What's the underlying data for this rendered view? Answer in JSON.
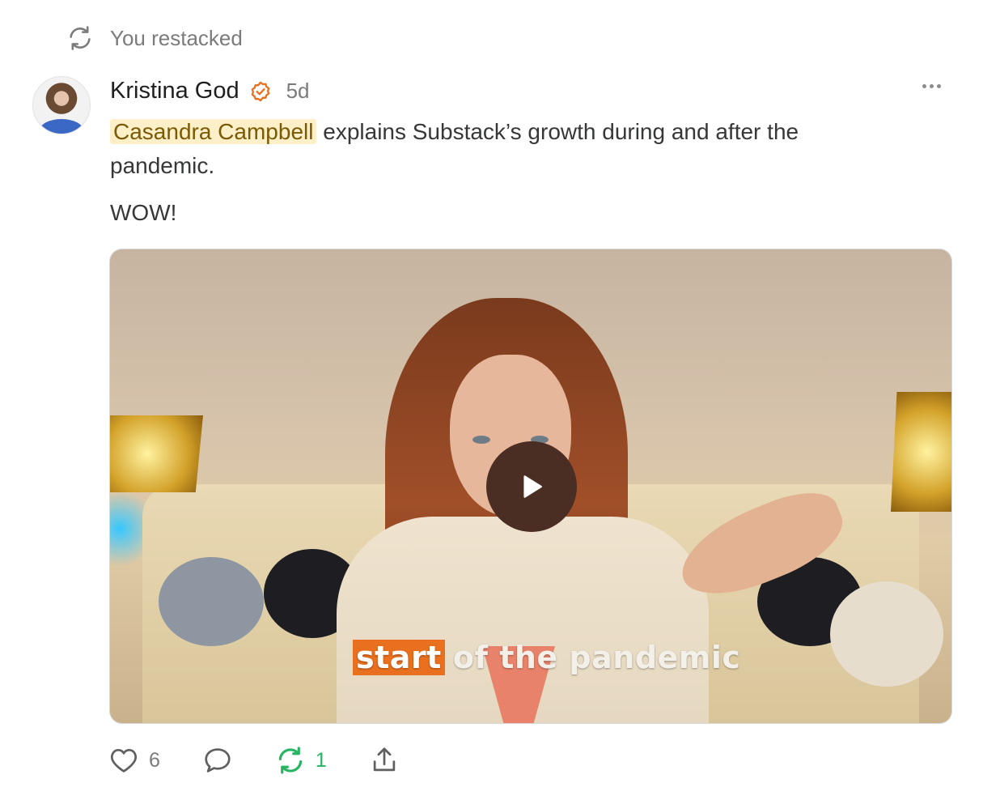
{
  "restack_notice": {
    "icon": "restack-icon",
    "text": "You restacked"
  },
  "post": {
    "author": {
      "name": "Kristina God",
      "verified_icon": "verified-badge-icon",
      "avatar_icon": "avatar"
    },
    "time": "5d",
    "menu_icon": "more-options-icon",
    "mention": "Casandra Campbell",
    "text_rest": "explains Substack’s growth during and after the pandemic.",
    "text_second": "WOW!",
    "video": {
      "play_icon": "play-icon",
      "caption_highlight": "start",
      "caption_rest": "of the pandemic"
    }
  },
  "actions": {
    "like": {
      "icon": "heart-icon",
      "count": "6"
    },
    "comment": {
      "icon": "comment-icon"
    },
    "restack": {
      "icon": "restack-icon",
      "count": "1"
    },
    "share": {
      "icon": "share-icon"
    }
  },
  "colors": {
    "accent_orange": "#e8701e",
    "mention_bg": "#fdf0c8",
    "restack_green": "#29b463",
    "muted_text": "#7b7b7b"
  }
}
